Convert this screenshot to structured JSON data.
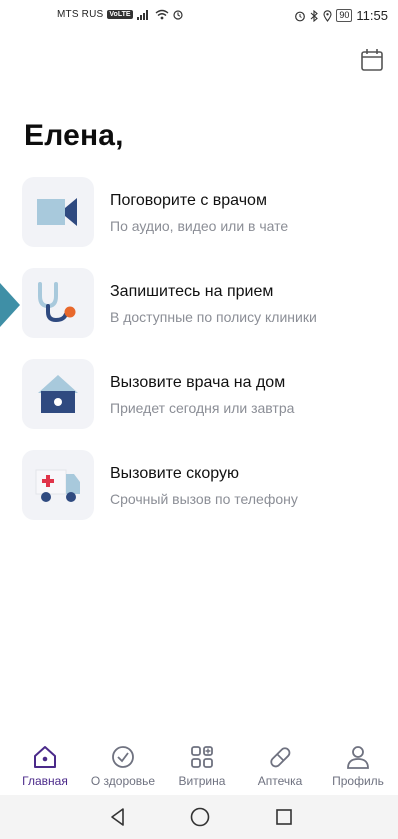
{
  "status_bar": {
    "carrier": "MTS RUS",
    "volte": "VoLTE",
    "battery": "90",
    "time": "11:55"
  },
  "header": {
    "calendar_icon": "calendar-icon"
  },
  "greeting": "Елена,",
  "actions": [
    {
      "title": "Поговорите с врачом",
      "subtitle": "По аудио, видео или в чате",
      "icon": "video-camera-icon"
    },
    {
      "title": "Запишитесь на прием",
      "subtitle": "В доступные по полису клиники",
      "icon": "stethoscope-icon"
    },
    {
      "title": "Вызовите врача на дом",
      "subtitle": "Приедет сегодня или завтра",
      "icon": "house-icon"
    },
    {
      "title": "Вызовите скорую",
      "subtitle": "Срочный вызов по телефону",
      "icon": "ambulance-icon"
    }
  ],
  "tabs": [
    {
      "label": "Главная",
      "icon": "home-icon",
      "active": true
    },
    {
      "label": "О здоровье",
      "icon": "check-circle-icon",
      "active": false
    },
    {
      "label": "Витрина",
      "icon": "showcase-grid-icon",
      "active": false
    },
    {
      "label": "Аптечка",
      "icon": "pill-icon",
      "active": false
    },
    {
      "label": "Профиль",
      "icon": "profile-icon",
      "active": false
    }
  ],
  "system_nav": [
    "back-icon",
    "home-circle-icon",
    "recents-icon"
  ],
  "colors": {
    "accent": "#4b2a8a",
    "tile_bg": "#f2f3f7",
    "secondary_text": "#8b8e96",
    "icon_blue": "#2f4a80",
    "icon_light_blue": "#a8c9dc",
    "icon_red": "#e0344a",
    "pointer": "#3f8fa6"
  }
}
